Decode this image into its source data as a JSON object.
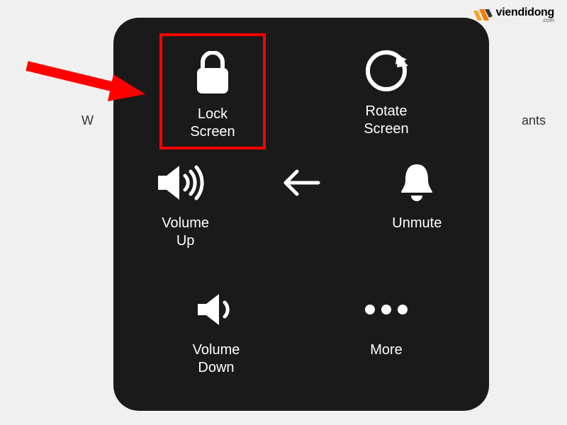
{
  "watermark": {
    "brand": "viendidong",
    "suffix": ".com"
  },
  "background": {
    "left_fragment": "W",
    "right_fragment": "ants"
  },
  "menu": {
    "lock_screen": "Lock\nScreen",
    "rotate_screen": "Rotate\nScreen",
    "volume_up": "Volume\nUp",
    "unmute": "Unmute",
    "volume_down": "Volume\nDown",
    "more": "More"
  },
  "highlight_color": "#ff0000"
}
